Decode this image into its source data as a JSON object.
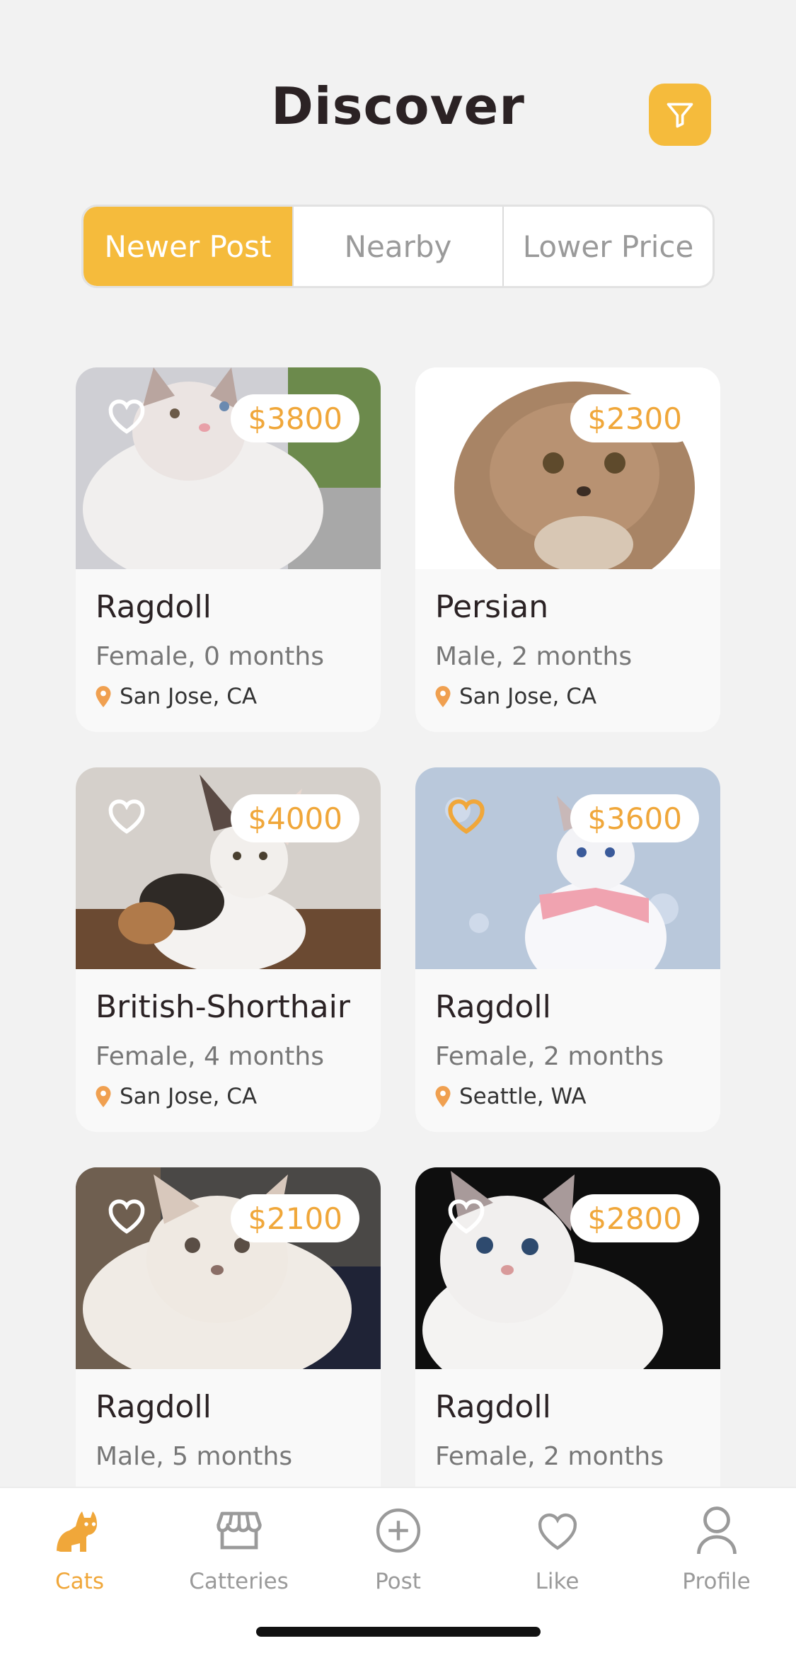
{
  "header": {
    "title": "Discover"
  },
  "filter_button": {
    "icon": "filter-icon",
    "color": "#f5bb3c"
  },
  "sort_tabs": [
    {
      "label": "Newer Post",
      "active": true
    },
    {
      "label": "Nearby",
      "active": false
    },
    {
      "label": "Lower Price",
      "active": false
    }
  ],
  "listings": [
    {
      "price": "$3800",
      "name": "Ragdoll",
      "details": "Female, 0 months",
      "location": "San Jose, CA",
      "liked": false
    },
    {
      "price": "$2300",
      "name": "Persian",
      "details": "Male, 2 months",
      "location": "San Jose, CA",
      "liked": false
    },
    {
      "price": "$4000",
      "name": "British-Shorthair",
      "details": "Female, 4 months",
      "location": "San Jose, CA",
      "liked": false
    },
    {
      "price": "$3600",
      "name": "Ragdoll",
      "details": "Female, 2 months",
      "location": "Seattle, WA",
      "liked": true
    },
    {
      "price": "$2100",
      "name": "Ragdoll",
      "details": "Male, 5 months",
      "location": "",
      "liked": false
    },
    {
      "price": "$2800",
      "name": "Ragdoll",
      "details": "Female, 2 months",
      "location": "",
      "liked": false
    }
  ],
  "tabbar": [
    {
      "label": "Cats",
      "icon": "cat-icon",
      "active": true
    },
    {
      "label": "Catteries",
      "icon": "storefront-icon",
      "active": false
    },
    {
      "label": "Post",
      "icon": "plus-circle-icon",
      "active": false
    },
    {
      "label": "Like",
      "icon": "heart-icon",
      "active": false
    },
    {
      "label": "Profile",
      "icon": "person-icon",
      "active": false
    }
  ],
  "colors": {
    "accent": "#f5bb3c",
    "price_text": "#f0a73a",
    "pin": "#f0a050"
  }
}
